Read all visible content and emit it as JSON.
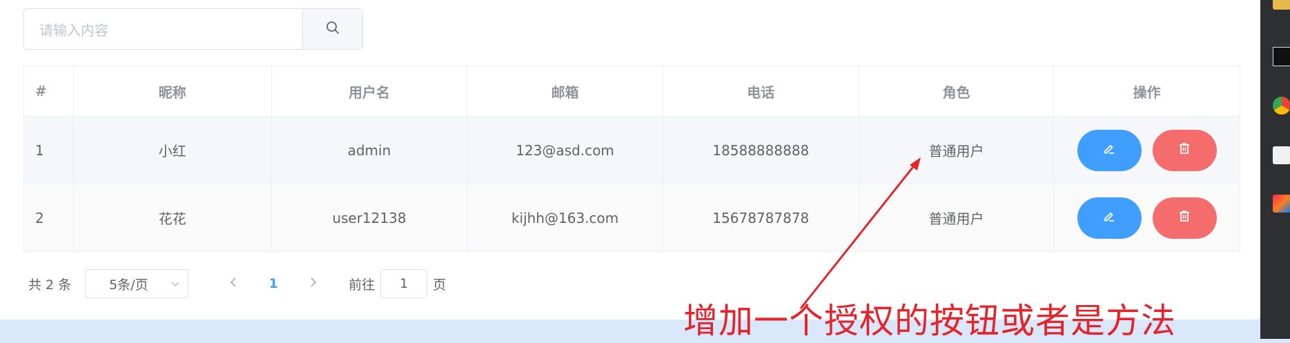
{
  "search": {
    "placeholder": "请输入内容"
  },
  "table": {
    "columns": [
      "#",
      "昵称",
      "用户名",
      "邮箱",
      "电话",
      "角色",
      "操作"
    ],
    "rows": [
      {
        "index": "1",
        "nickname": "小红",
        "username": "admin",
        "email": "123@asd.com",
        "phone": "18588888888",
        "role": "普通用户"
      },
      {
        "index": "2",
        "nickname": "花花",
        "username": "user12138",
        "email": "kijhh@163.com",
        "phone": "15678787878",
        "role": "普通用户"
      }
    ]
  },
  "pagination": {
    "total_text": "共 2 条",
    "page_size": "5条/页",
    "current_page": "1",
    "goto_prefix": "前往",
    "goto_value": "1",
    "goto_suffix": "页"
  },
  "annotation": {
    "text": "增加一个授权的按钮或者是方法"
  },
  "colors": {
    "primary": "#409eff",
    "danger": "#f56c6c",
    "annotation": "#e3242b"
  }
}
